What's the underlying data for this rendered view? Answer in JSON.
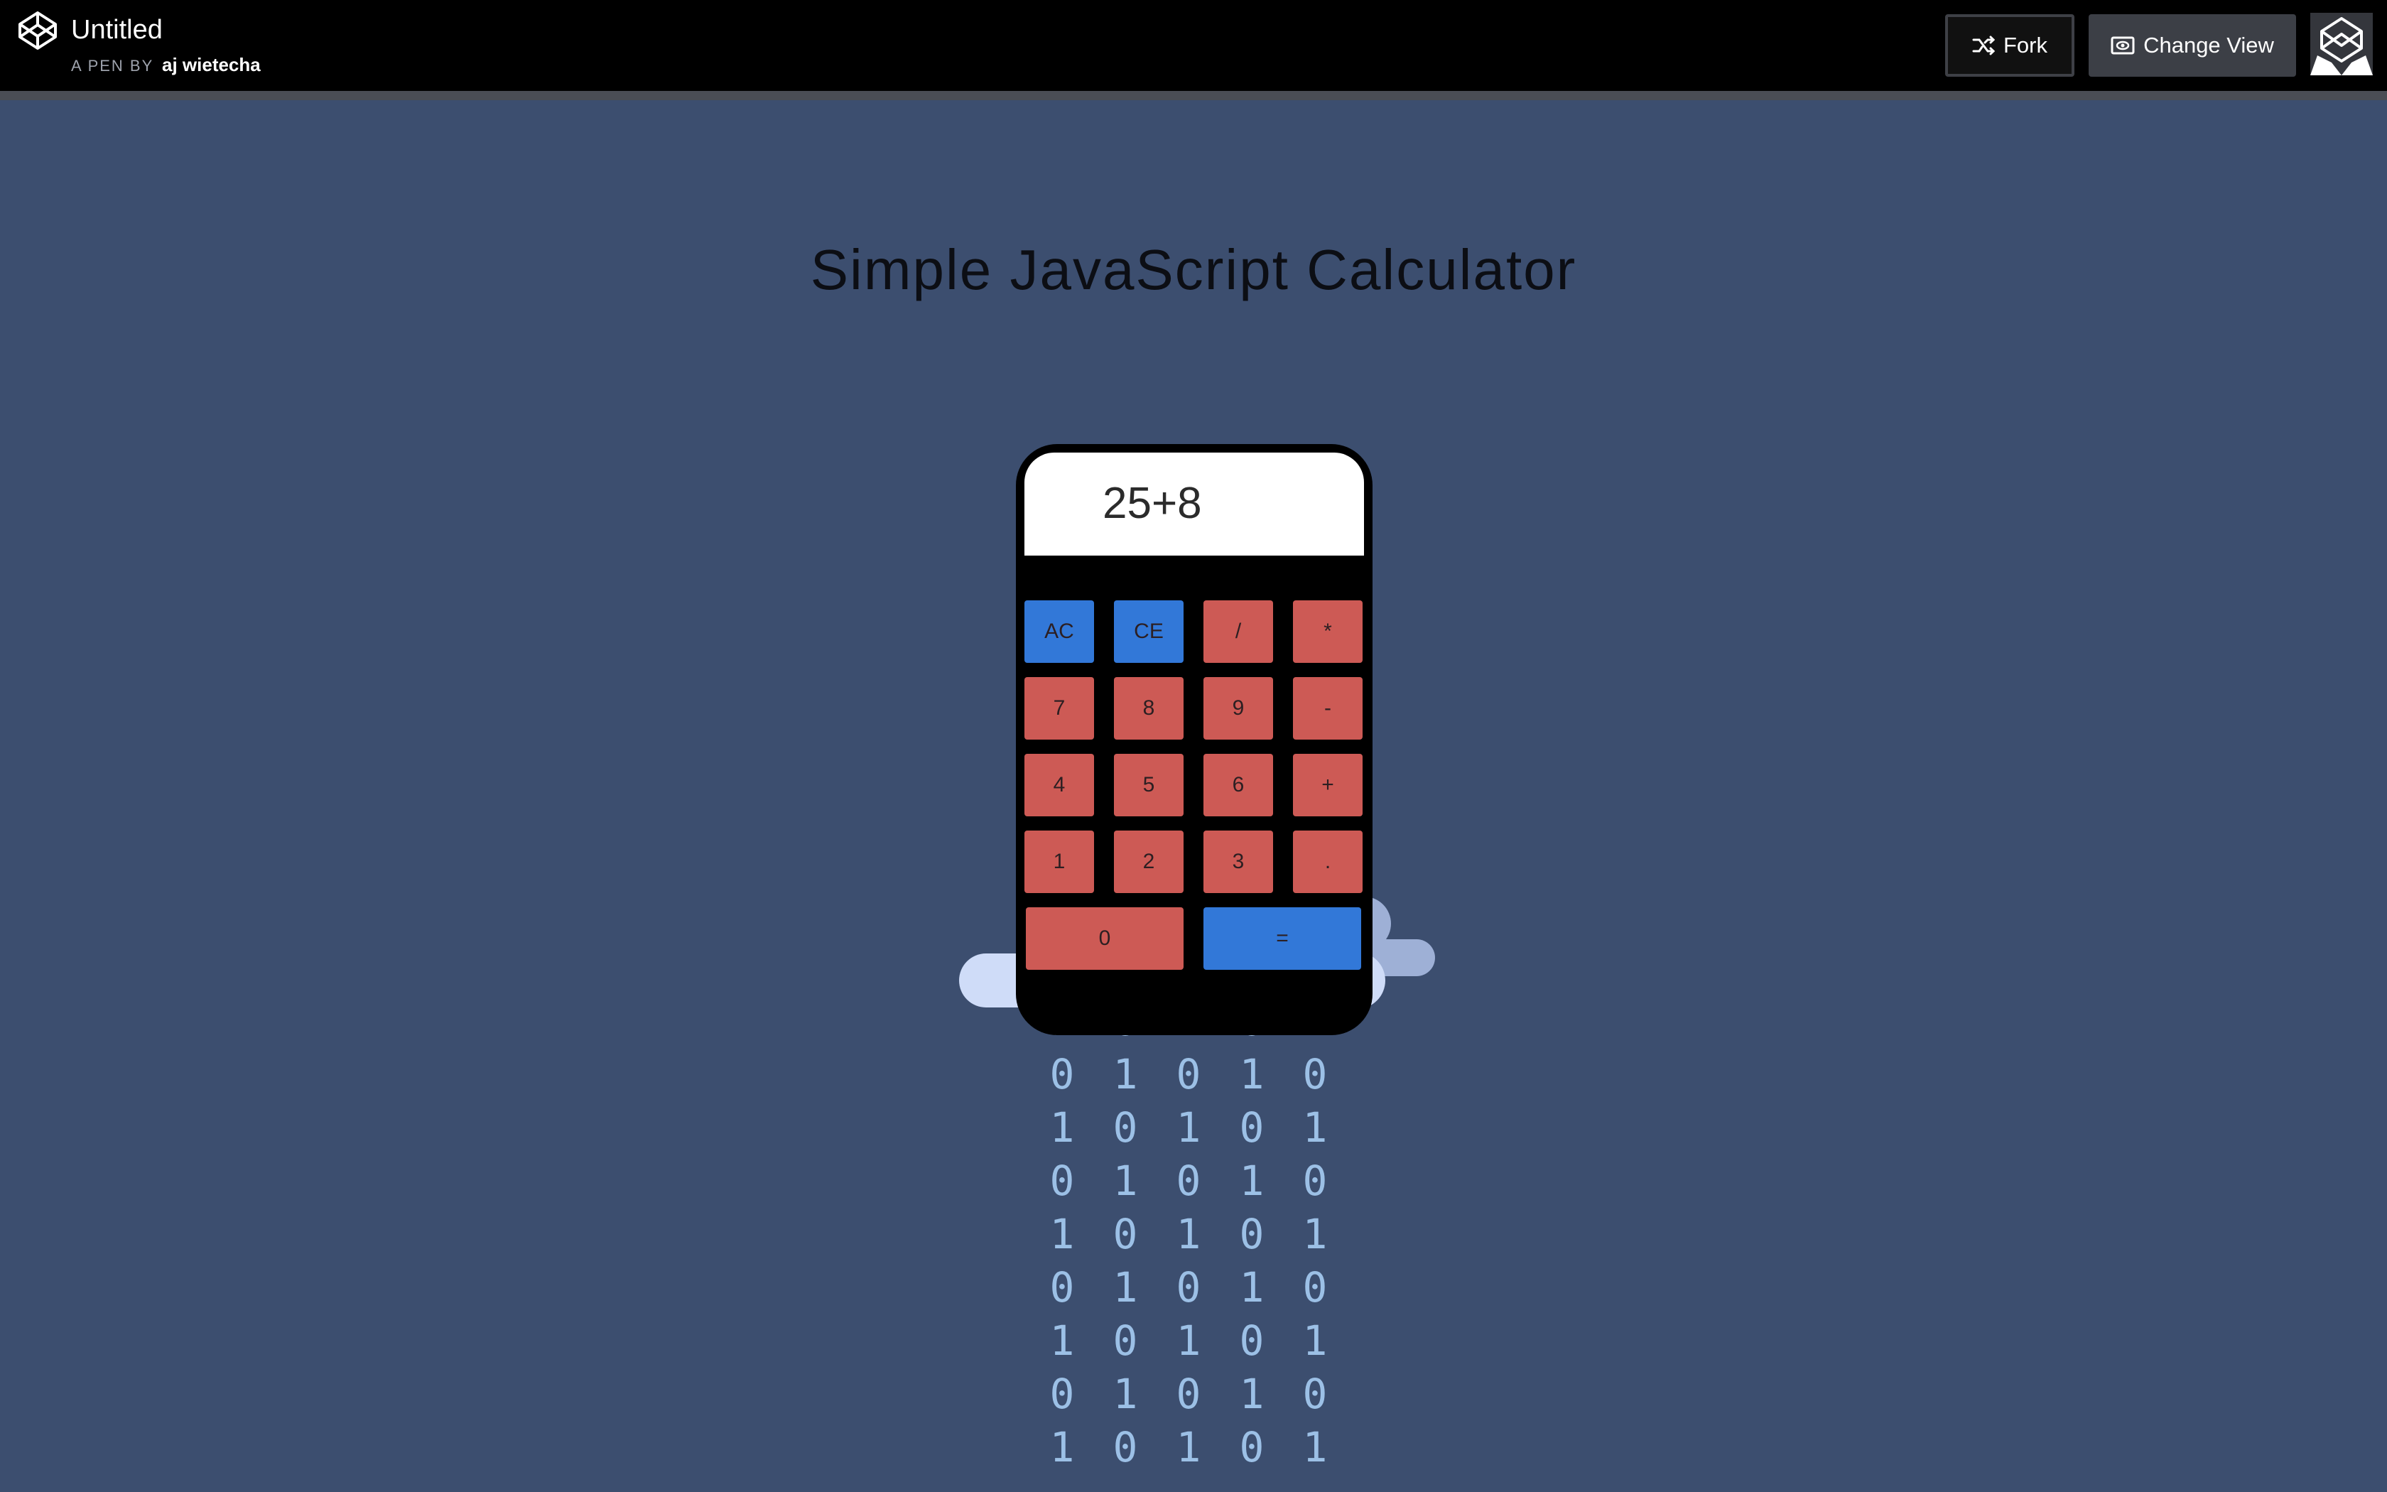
{
  "header": {
    "pen_title": "Untitled",
    "pen_by_label": "A PEN BY",
    "author": "aj wietecha",
    "fork_label": "Fork",
    "change_view_label": "Change View"
  },
  "page": {
    "title": "Simple JavaScript Calculator"
  },
  "calculator": {
    "display": "25+8",
    "keys": {
      "ac": "AC",
      "ce": "CE",
      "divide": "/",
      "multiply": "*",
      "seven": "7",
      "eight": "8",
      "nine": "9",
      "minus": "-",
      "four": "4",
      "five": "5",
      "six": "6",
      "plus": "+",
      "one": "1",
      "two": "2",
      "three": "3",
      "decimal": ".",
      "zero": "0",
      "equals": "="
    }
  },
  "binary_rain": {
    "col1": "1\n0\n1\n0\n1\n0\n1\n0\n1",
    "col2": "0\n1\n0\n1\n0\n1\n0\n1\n0",
    "col3": "1\n0\n1\n0\n1\n0\n1\n0\n1",
    "col4": "0\n1\n0\n1\n0\n1\n0\n1\n0",
    "col5": "1\n0\n1\n0\n1\n0\n1\n0\n1"
  },
  "colors": {
    "background": "#3c4e6f",
    "number_key": "#cd5a55",
    "action_key": "#3278d8",
    "binary_digits": "#9cc0e6"
  }
}
